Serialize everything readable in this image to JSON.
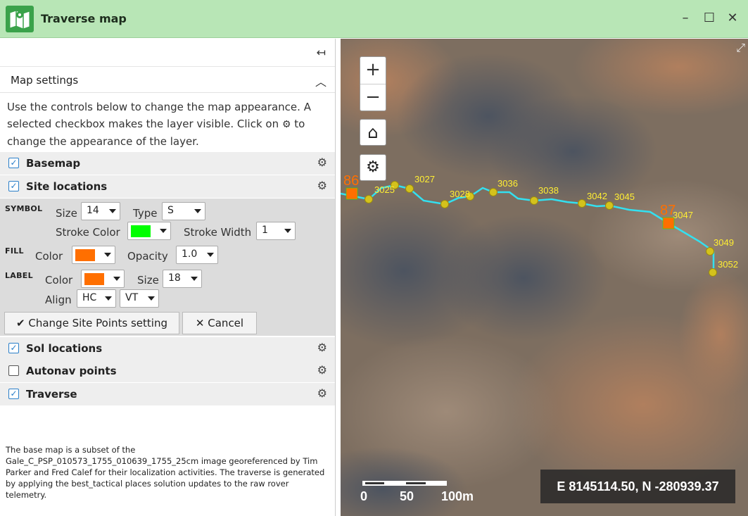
{
  "window": {
    "title": "Traverse map",
    "minimize": "–",
    "maximize": "☐",
    "close": "✕",
    "colors": {
      "titlebar": "#b8e6b6",
      "app_icon": "#3aa24a"
    }
  },
  "panel": {
    "collapse_icon": "↤",
    "section_title": "Map settings",
    "section_chevron": "︿",
    "intro_before": "Use the controls below to change the map appearance. A selected checkbox makes the layer visible. Click on",
    "intro_after": "to change the appearance of the layer.",
    "layers": [
      {
        "label": "Basemap",
        "checked": true
      },
      {
        "label": "Site locations",
        "checked": true
      },
      {
        "label": "Sol locations",
        "checked": true
      },
      {
        "label": "Autonav points",
        "checked": false
      },
      {
        "label": "Traverse",
        "checked": true
      }
    ],
    "site_settings": {
      "symbol_group": "SYMBOL",
      "size_label": "Size",
      "size_value": "14",
      "type_label": "Type",
      "type_value": "S",
      "stroke_color_label": "Stroke Color",
      "stroke_color": "#00ff00",
      "stroke_width_label": "Stroke Width",
      "stroke_width_value": "1",
      "fill_group": "FILL",
      "fill_color_label": "Color",
      "fill_color": "#ff6f00",
      "opacity_label": "Opacity",
      "opacity_value": "1.0",
      "label_group": "LABEL",
      "label_color_label": "Color",
      "label_color": "#ff6f00",
      "label_size_label": "Size",
      "label_size_value": "18",
      "align_label": "Align",
      "align_h": "HC",
      "align_v": "VT",
      "apply_button": "Change Site Points setting",
      "cancel_button": "Cancel"
    },
    "footnote": "The base map is a subset of the Gale_C_PSP_010573_1755_010639_1755_25cm image georeferenced by Tim Parker and Fred Calef for their localization activities. The traverse is generated by applying the best_tactical places solution updates to the raw rover telemetry."
  },
  "map": {
    "zoom_in": "+",
    "zoom_out": "−",
    "home_icon": "⌂",
    "settings_icon": "⚙",
    "coordinates": "E 8145114.50, N -280939.37",
    "scale_labels": [
      "0",
      "50",
      "100m"
    ],
    "traverse_color": "#33e0f0",
    "sol_point_color": "#d4c21c",
    "sol_label_color": "#ffee33",
    "sites": [
      {
        "label": "86"
      },
      {
        "label": "87"
      }
    ],
    "sols": [
      {
        "label": "3025"
      },
      {
        "label": "3027"
      },
      {
        "label": "3028"
      },
      {
        "label": "3036"
      },
      {
        "label": "3038"
      },
      {
        "label": "3042"
      },
      {
        "label": "3045"
      },
      {
        "label": "3047"
      },
      {
        "label": "3049"
      },
      {
        "label": "3052"
      }
    ]
  }
}
